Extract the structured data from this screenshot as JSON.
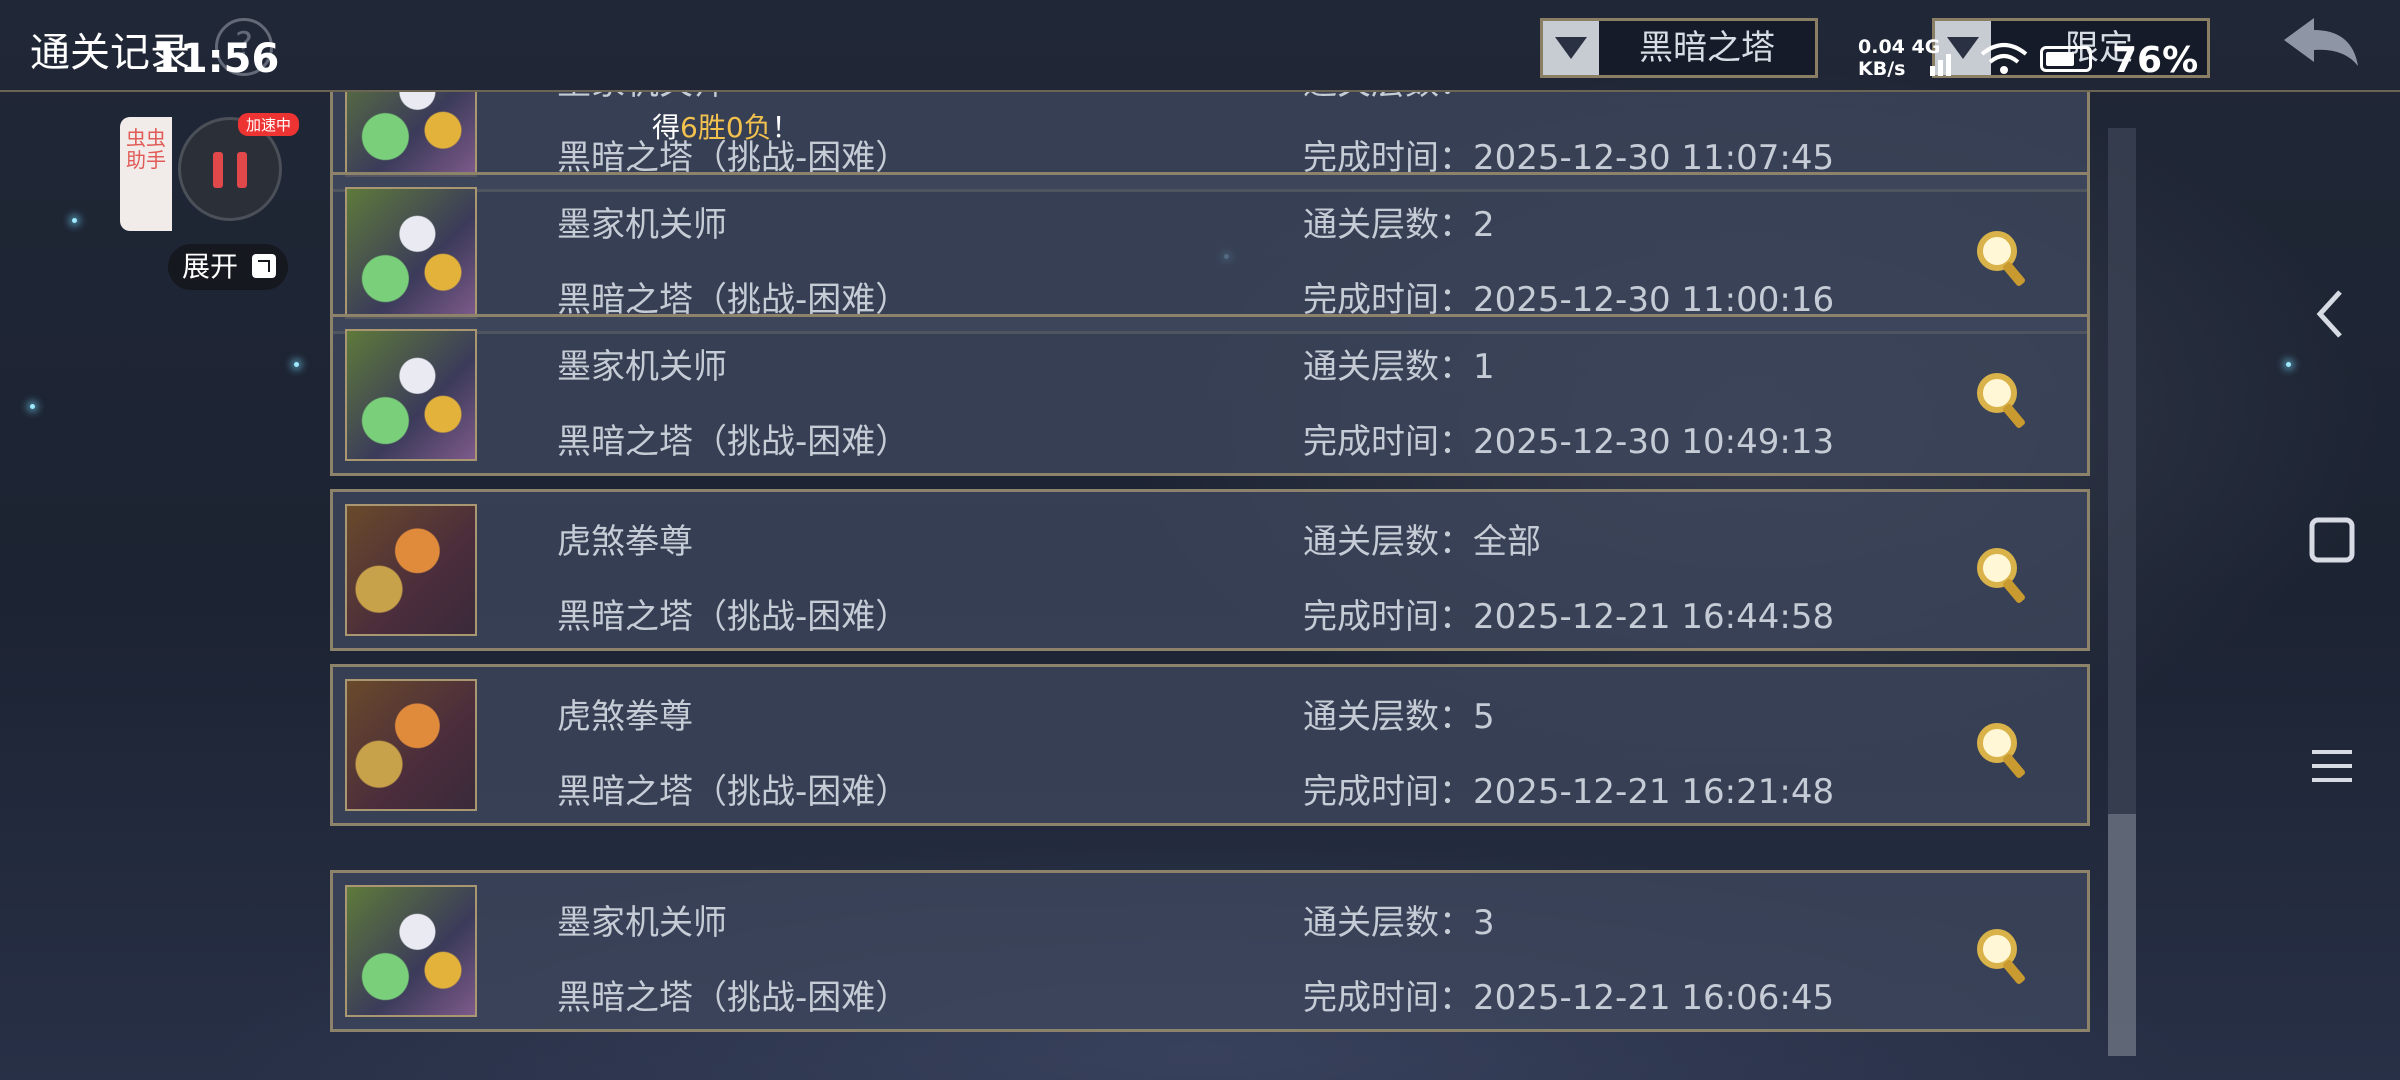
{
  "status_bar": {
    "time": "11:56",
    "network_speed_line1": "0.04 4G",
    "network_speed_line2": "KB/s",
    "battery": "76%"
  },
  "header": {
    "title": "通关记录",
    "help_symbol": "?",
    "filter_mode": "黑暗之塔",
    "filter_range": "限定"
  },
  "helper": {
    "tab_label": "虫虫助手",
    "speed_badge": "加速中",
    "expand_label": "展开"
  },
  "toast": {
    "prefix": "得",
    "highlight": "6胜0负",
    "suffix": "！"
  },
  "records": [
    {
      "character": "墨家机关师",
      "mode": "黑暗之塔（挑战-困难）",
      "floors_label": "通关层数：",
      "floors": "",
      "time_label": "完成时间：",
      "time": "2025-12-30 11:07:45"
    },
    {
      "character": "墨家机关师",
      "mode": "黑暗之塔（挑战-困难）",
      "floors_label": "通关层数：",
      "floors": "2",
      "time_label": "完成时间：",
      "time": "2025-12-30 11:00:16"
    },
    {
      "character": "墨家机关师",
      "mode": "黑暗之塔（挑战-困难）",
      "floors_label": "通关层数：",
      "floors": "1",
      "time_label": "完成时间：",
      "time": "2025-12-30 10:49:13"
    },
    {
      "character": "虎煞拳尊",
      "mode": "黑暗之塔（挑战-困难）",
      "floors_label": "通关层数：",
      "floors": "全部",
      "time_label": "完成时间：",
      "time": "2025-12-21 16:44:58"
    },
    {
      "character": "虎煞拳尊",
      "mode": "黑暗之塔（挑战-困难）",
      "floors_label": "通关层数：",
      "floors": "5",
      "time_label": "完成时间：",
      "time": "2025-12-21 16:21:48"
    },
    {
      "character": "墨家机关师",
      "mode": "黑暗之塔（挑战-困难）",
      "floors_label": "通关层数：",
      "floors": "3",
      "time_label": "完成时间：",
      "time": "2025-12-21 16:06:45"
    }
  ],
  "icons": {
    "back": "back-arrow-icon",
    "detail": "magnifier-icon",
    "nav_back": "chevron-left-icon",
    "nav_home": "square-icon",
    "nav_menu": "hamburger-icon"
  },
  "colors": {
    "frame_gold": "#8d836a",
    "highlight_gold": "#f2c14e",
    "helper_red": "#e05b58"
  }
}
